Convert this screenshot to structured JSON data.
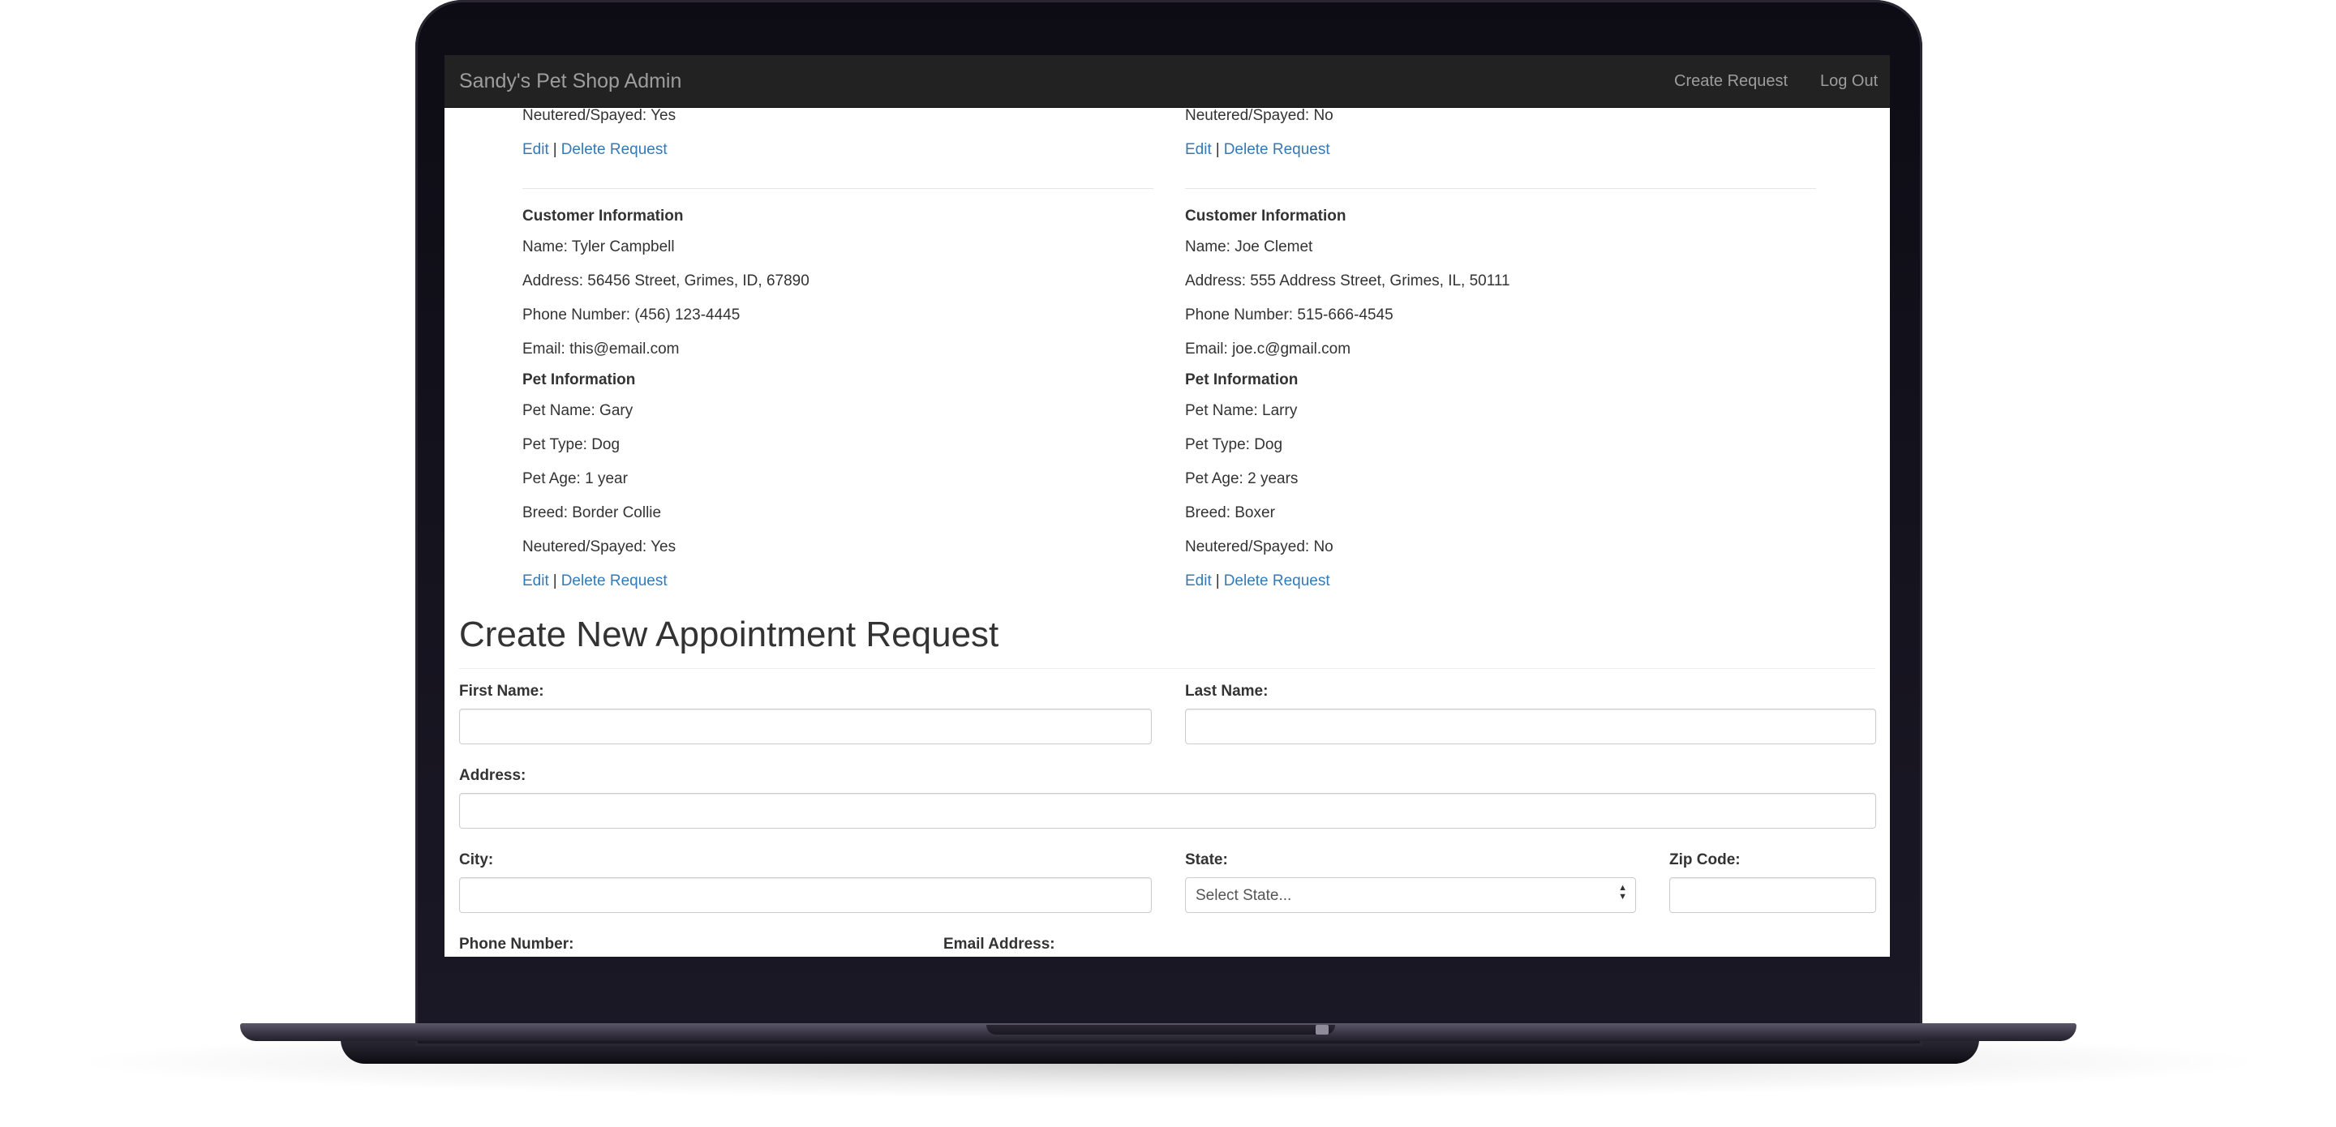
{
  "navbar": {
    "brand": "Sandy's Pet Shop Admin",
    "links": [
      "Create Request",
      "Log Out"
    ]
  },
  "partial_top": [
    {
      "neutered": "Neutered/Spayed: Yes",
      "edit": "Edit",
      "separator": "|",
      "delete": "Delete Request"
    },
    {
      "neutered": "Neutered/Spayed: No",
      "edit": "Edit",
      "separator": "|",
      "delete": "Delete Request"
    }
  ],
  "requests": [
    {
      "customer_heading": "Customer Information",
      "name": "Name: Tyler Campbell",
      "address": "Address: 56456 Street, Grimes, ID, 67890",
      "phone": "Phone Number: (456) 123-4445",
      "email": "Email: this@email.com",
      "pet_heading": "Pet Information",
      "pet_name": "Pet Name: Gary",
      "pet_type": "Pet Type: Dog",
      "pet_age": "Pet Age: 1 year",
      "breed": "Breed: Border Collie",
      "neutered": "Neutered/Spayed: Yes",
      "edit": "Edit",
      "separator": "|",
      "delete": "Delete Request"
    },
    {
      "customer_heading": "Customer Information",
      "name": "Name: Joe Clemet",
      "address": "Address: 555 Address Street, Grimes, IL, 50111",
      "phone": "Phone Number: 515-666-4545",
      "email": "Email: joe.c@gmail.com",
      "pet_heading": "Pet Information",
      "pet_name": "Pet Name: Larry",
      "pet_type": "Pet Type: Dog",
      "pet_age": "Pet Age: 2 years",
      "breed": "Breed: Boxer",
      "neutered": "Neutered/Spayed: No",
      "edit": "Edit",
      "separator": "|",
      "delete": "Delete Request"
    }
  ],
  "form": {
    "title": "Create New Appointment Request",
    "first_name_label": "First Name:",
    "first_name_value": "",
    "last_name_label": "Last Name:",
    "last_name_value": "",
    "address_label": "Address:",
    "address_value": "",
    "city_label": "City:",
    "city_value": "",
    "state_label": "State:",
    "state_selected": "Select State...",
    "zip_label": "Zip Code:",
    "zip_value": "",
    "phone_label": "Phone Number:",
    "email_label": "Email Address:"
  }
}
